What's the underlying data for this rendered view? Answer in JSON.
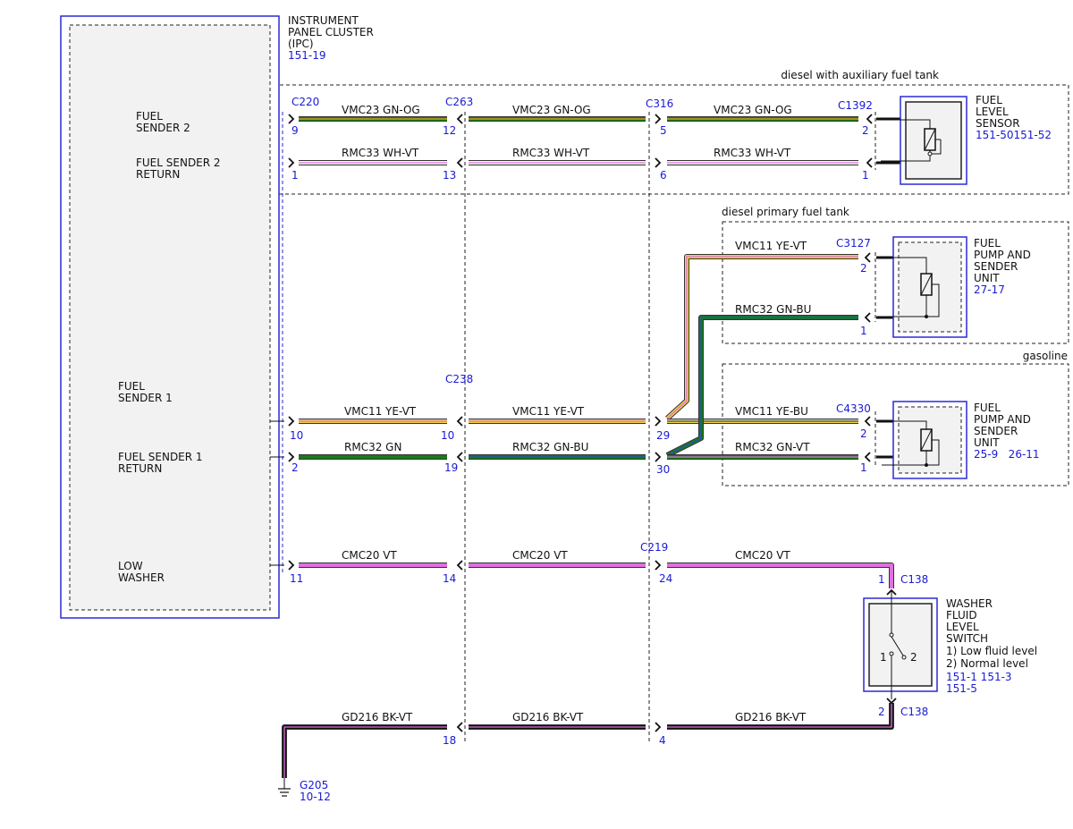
{
  "colors": {
    "GN": "#1a7a1a",
    "OG": "#f0a020",
    "WH": "#f4f4f4",
    "VT": "#e070e0",
    "YE": "#f2d23a",
    "BU": "#2050c8",
    "BK": "#111111",
    "blue_text": "#1a1ad6"
  },
  "ipc": {
    "title_lines": [
      "INSTRUMENT",
      "PANEL CLUSTER",
      "(IPC)"
    ],
    "ref": "151-19"
  },
  "regions": {
    "aux": "diesel with auxiliary fuel tank",
    "primary": "diesel primary fuel tank",
    "gasoline": "gasoline"
  },
  "ipc_pins": {
    "sender2": [
      "FUEL",
      "SENDER 2"
    ],
    "sender2_return": [
      "FUEL SENDER 2",
      "RETURN"
    ],
    "sender1": [
      "FUEL",
      "SENDER 1"
    ],
    "sender1_return": [
      "FUEL SENDER 1",
      "RETURN"
    ],
    "low_washer": [
      "LOW",
      "WASHER"
    ]
  },
  "connectors": {
    "C220": "C220",
    "C263": "C263",
    "C316": "C316",
    "C1392": "C1392",
    "C238": "C238",
    "C3127": "C3127",
    "C4330": "C4330",
    "C219": "C219",
    "C138a": "C138",
    "C138b": "C138"
  },
  "pins": {
    "p9": "9",
    "p12": "12",
    "p5": "5",
    "p2a": "2",
    "p1a": "1",
    "p13": "13",
    "p6": "6",
    "p1b": "1",
    "p2b": "2",
    "p1c": "1",
    "p10a": "10",
    "p10b": "10",
    "p29": "29",
    "p2c": "2",
    "p2d": "2",
    "p19": "19",
    "p30": "30",
    "p1d": "1",
    "p11": "11",
    "p14": "14",
    "p24": "24",
    "p1e": "1",
    "p18": "18",
    "p4": "4",
    "p2e": "2"
  },
  "wires": {
    "w1a": "VMC23  GN-OG",
    "w1b": "VMC23  GN-OG",
    "w1c": "VMC23  GN-OG",
    "w2a": "RMC33   WH-VT",
    "w2b": "RMC33   WH-VT",
    "w2c": "RMC33   WH-VT",
    "w3a": "VMC11 YE-VT",
    "w3b": "RMC32 GN-BU",
    "w4a": "VMC11  YE-VT",
    "w4b": "VMC11 YE-VT",
    "w4c": "VMC11 YE-BU",
    "w5a": "RMC32  GN",
    "w5b": "RMC32 GN-BU",
    "w5c": "RMC32 GN-VT",
    "w6a": "CMC20   VT",
    "w6b": "CMC20   VT",
    "w6c": "CMC20   VT",
    "w7a": "GD216  BK-VT",
    "w7b": "GD216  BK-VT",
    "w7c": "GD216  BK-VT"
  },
  "components": {
    "fuel_level_sensor": {
      "lines": [
        "FUEL",
        "LEVEL",
        "SENSOR"
      ],
      "ref": "151-50151-52"
    },
    "pump_primary": {
      "lines": [
        "FUEL",
        "PUMP AND",
        "SENDER",
        "UNIT"
      ],
      "ref": "27-17"
    },
    "pump_gasoline": {
      "lines": [
        "FUEL",
        "PUMP AND",
        "SENDER",
        "UNIT"
      ],
      "ref": "25-9   26-11"
    },
    "washer_switch": {
      "lines": [
        "WASHER",
        "FLUID",
        "LEVEL",
        "SWITCH",
        "1) Low fluid level",
        "2) Normal level"
      ],
      "refs": [
        "151-1 151-3",
        "151-5"
      ],
      "pin1": "1",
      "pin2": "2"
    }
  },
  "ground": {
    "name": "G205",
    "ref": "10-12"
  }
}
